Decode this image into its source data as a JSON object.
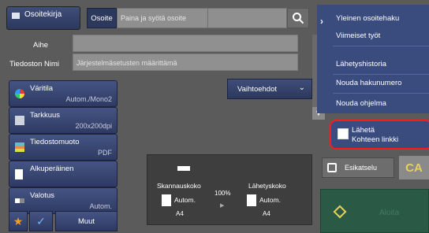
{
  "top": {
    "address_book_label": "Osoitekirja",
    "address_tab_label": "Osoite",
    "address_placeholder": "Paina ja syötä osoite"
  },
  "fields": {
    "subject_label": "Aihe",
    "subject_value": "",
    "filename_label": "Tiedoston Nimi",
    "filename_placeholder": "Järjestelmäsetusten määrittämä"
  },
  "functions": [
    {
      "label": "Väritila",
      "value": "Autom./Mono2"
    },
    {
      "label": "Tarkkuus",
      "value": "200x200dpi"
    },
    {
      "label": "Tiedostomuoto",
      "value": "PDF"
    },
    {
      "label": "Alkuperäinen",
      "value": ""
    },
    {
      "label": "Valotus",
      "value": "Autom."
    }
  ],
  "options_label": "Vaihtoehdot",
  "preview": {
    "scan_size_label": "Skannauskoko",
    "scan_size_value": "Autom.",
    "scan_paper": "A4",
    "ratio": "100%",
    "send_size_label": "Lähetyskoko",
    "send_size_value": "Autom.",
    "send_paper": "A4"
  },
  "menu": {
    "items": [
      "Yleinen osoitehaku",
      "Viimeiset työt",
      "Lähetyshistoria",
      "Nouda hakunumero",
      "Nouda ohjelma"
    ],
    "send_link_line1": "Lähetä",
    "send_link_line2": "Kohteen linkki"
  },
  "preview_button_label": "Esikatselu",
  "ca_label": "CA",
  "start_label": "Aloita",
  "more_label": "Muut",
  "colors": {
    "accent": "#3a4b7e",
    "highlight": "#ff1a1a",
    "star": "#f0a02a",
    "check": "#7fb3ff"
  }
}
